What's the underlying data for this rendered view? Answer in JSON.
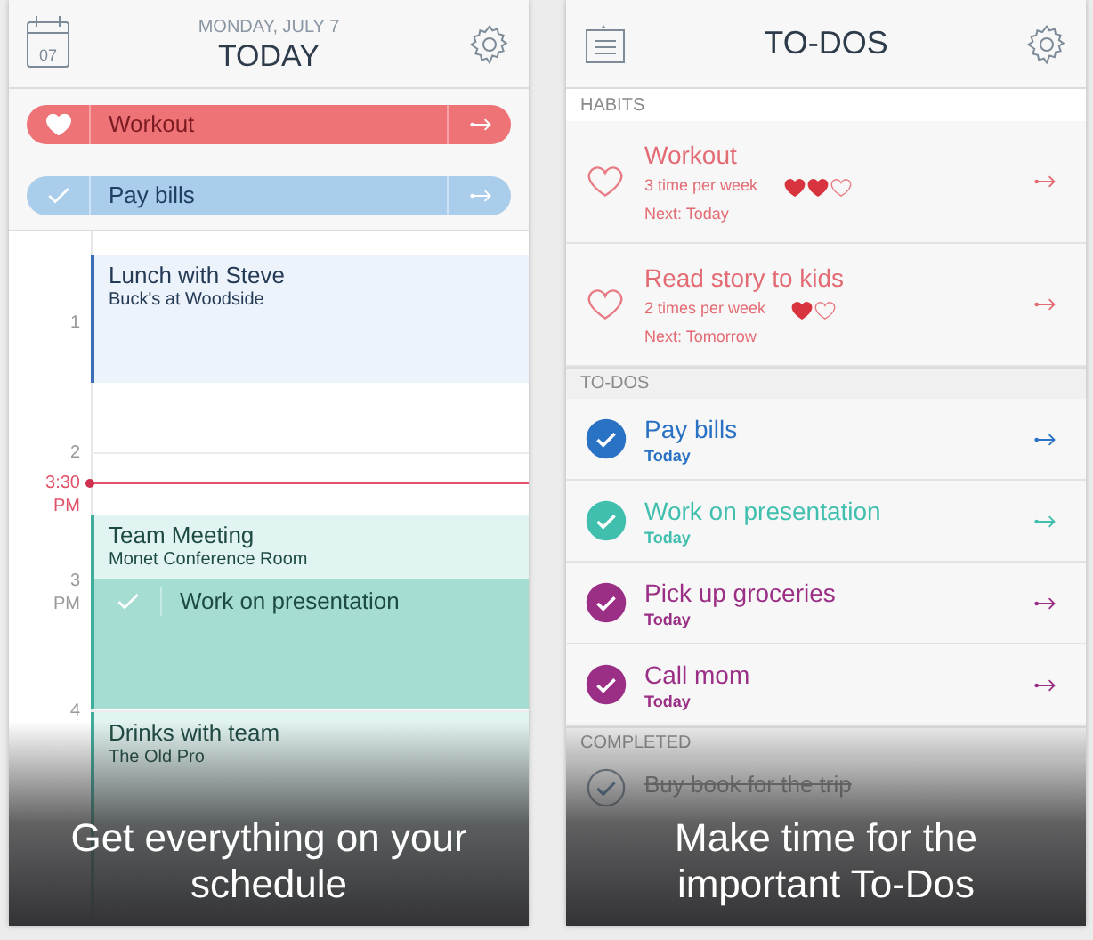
{
  "screens": [
    {
      "kind": "calendar",
      "date": "MONDAY, JULY 7",
      "title": "TODAY",
      "calendar_icon_day": "07",
      "pills": [
        {
          "kind": "habit",
          "label": "Workout"
        },
        {
          "kind": "todo",
          "label": "Pay bills"
        }
      ],
      "hours": [
        {
          "kind": "hour",
          "label": "1"
        },
        {
          "kind": "hour",
          "label": "2"
        },
        {
          "kind": "now",
          "label": "3:30",
          "sub": "PM"
        },
        {
          "kind": "hour",
          "label": "3",
          "sub": "PM"
        },
        {
          "kind": "hour",
          "label": "4"
        }
      ],
      "events": [
        {
          "kind": "event",
          "title": "Lunch with Steve",
          "location": "Buck's at Woodside",
          "color": "#3b6fb5"
        },
        {
          "kind": "event",
          "title": "Team Meeting",
          "location": "Monet Conference Room",
          "color": "#3fae9c"
        },
        {
          "kind": "task",
          "title": "Work on presentation",
          "color": "#3fae9c"
        },
        {
          "kind": "event",
          "title": "Drinks with team",
          "location": "The Old Pro",
          "color": "#3fae9c"
        }
      ],
      "caption": "Get everything on your schedule"
    },
    {
      "kind": "todos",
      "title": "TO-DOS",
      "sections": [
        {
          "header": "HABITS",
          "kind": "habits",
          "items": [
            {
              "title": "Workout",
              "frequency": "3 time per week",
              "next": "Next: Today",
              "hearts": [
                {
                  "filled": true
                },
                {
                  "filled": true
                },
                {
                  "filled": false
                }
              ]
            },
            {
              "title": "Read story to kids",
              "frequency": "2 times per week",
              "next": "Next: Tomorrow",
              "hearts": [
                {
                  "filled": true
                },
                {
                  "filled": false
                }
              ]
            }
          ]
        },
        {
          "header": "TO-DOS",
          "kind": "todos",
          "items": [
            {
              "title": "Pay bills",
              "due": "Today",
              "color": "#2a72c4",
              "checked": true
            },
            {
              "title": "Work on presentation",
              "due": "Today",
              "color": "#41bfae",
              "checked": true
            },
            {
              "title": "Pick up groceries",
              "due": "Today",
              "color": "#9b2f86",
              "checked": true
            },
            {
              "title": "Call mom",
              "due": "Today",
              "color": "#9b2f86",
              "checked": true
            }
          ]
        },
        {
          "header": "COMPLETED",
          "kind": "completed",
          "items": [
            {
              "title": "Buy book for the trip",
              "checked": true
            }
          ]
        }
      ],
      "caption": "Make time for the important To-Dos"
    }
  ]
}
